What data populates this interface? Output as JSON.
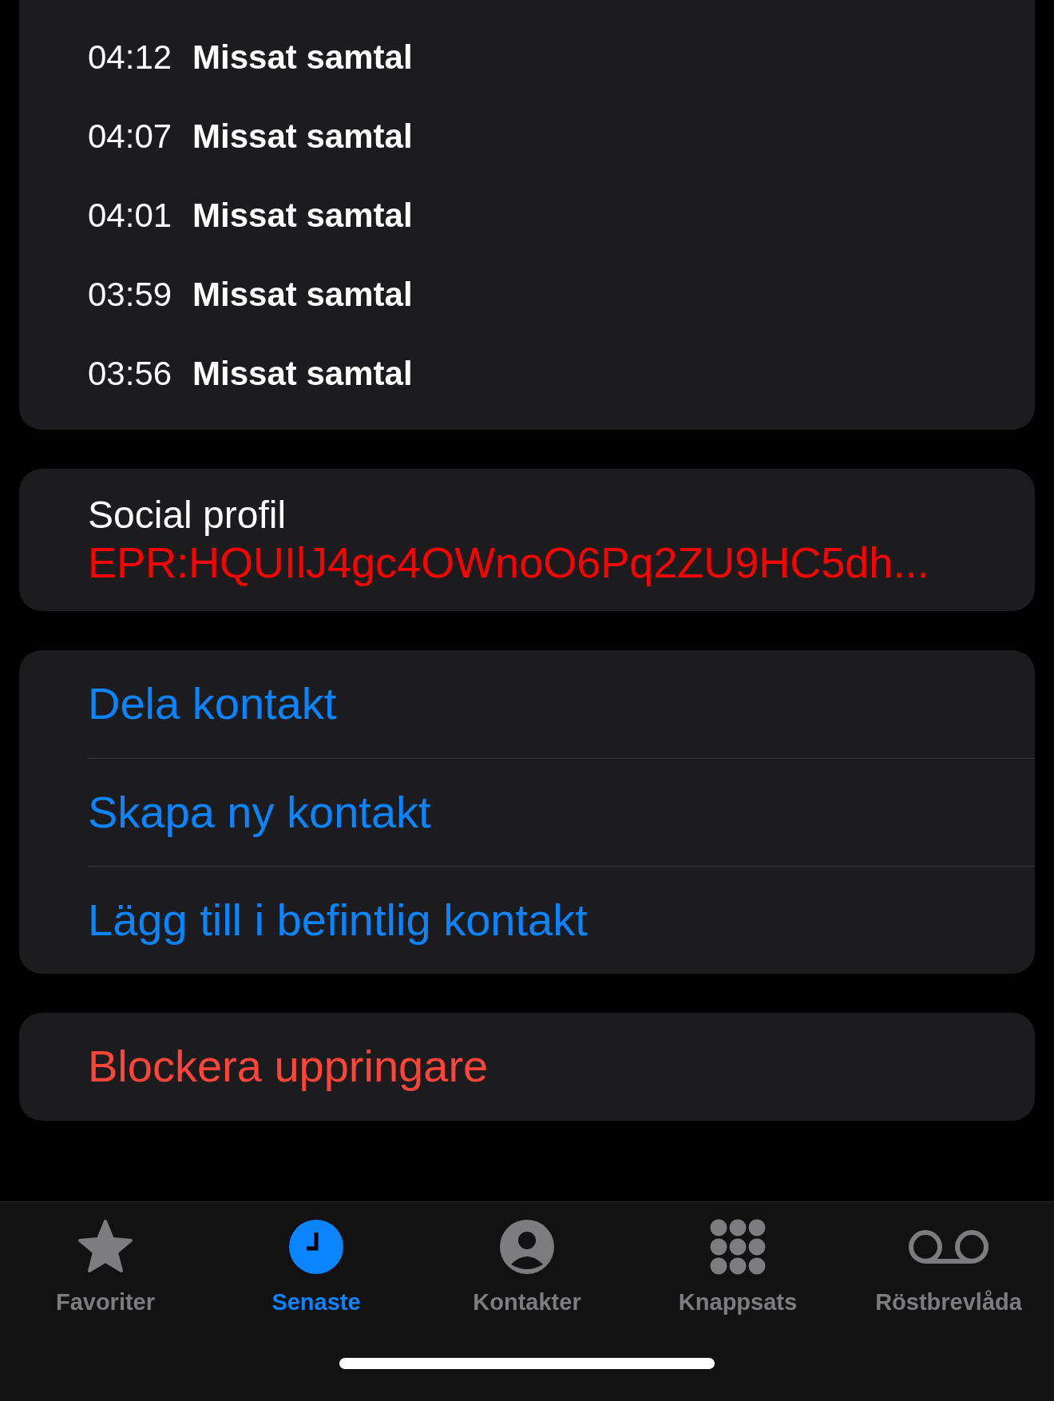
{
  "calls": [
    {
      "time": "04:12",
      "label": "Missat samtal"
    },
    {
      "time": "04:07",
      "label": "Missat samtal"
    },
    {
      "time": "04:01",
      "label": "Missat samtal"
    },
    {
      "time": "03:59",
      "label": "Missat samtal"
    },
    {
      "time": "03:56",
      "label": "Missat samtal"
    }
  ],
  "social_profile": {
    "label": "Social profil",
    "value": "EPR:HQUIlJ4gc4OWnoO6Pq2ZU9HC5dh..."
  },
  "actions": [
    {
      "label": "Dela kontakt"
    },
    {
      "label": "Skapa ny kontakt"
    },
    {
      "label": "Lägg till i befintlig kontakt"
    }
  ],
  "block": {
    "label": "Blockera uppringare"
  },
  "tabs": [
    {
      "label": "Favoriter",
      "selected": false
    },
    {
      "label": "Senaste",
      "selected": true
    },
    {
      "label": "Kontakter",
      "selected": false
    },
    {
      "label": "Knappsats",
      "selected": false
    },
    {
      "label": "Röstbrevlåda",
      "selected": false
    }
  ]
}
